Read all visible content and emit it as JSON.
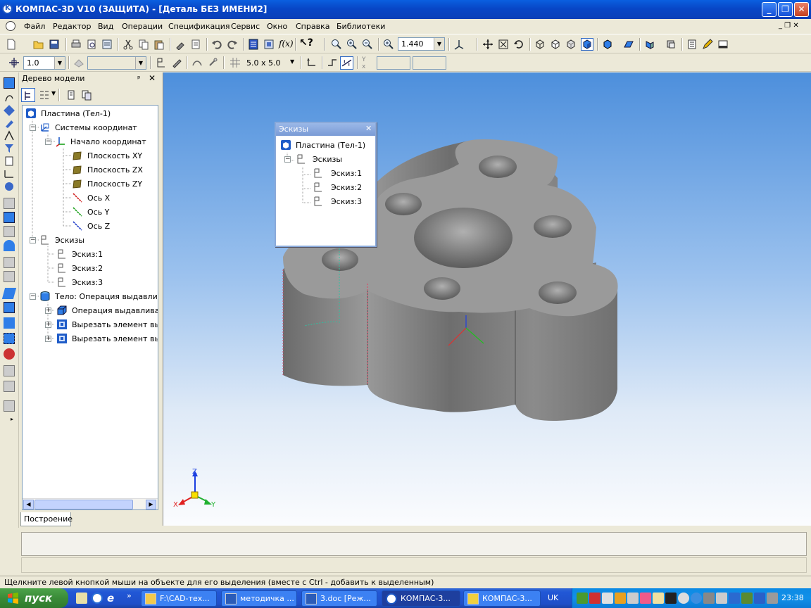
{
  "window": {
    "title": "КОМПАС-3D V10 (ЗАЩИТА) - [Деталь БЕЗ ИМЕНИ2]"
  },
  "menu": {
    "items": [
      "Файл",
      "Редактор",
      "Вид",
      "Операции",
      "Спецификация",
      "Сервис",
      "Окно",
      "Справка",
      "Библиотеки"
    ]
  },
  "toolbar": {
    "zoom_value": "1.440",
    "scale_value": "1.0",
    "grid_value": "5.0 x 5.0"
  },
  "tree_panel": {
    "title": "Дерево модели",
    "tab_label": "Построение",
    "items": [
      {
        "label": "Пластина  (Тел-1)"
      },
      {
        "label": "Системы координат"
      },
      {
        "label": "Начало координат"
      },
      {
        "label": "Плоскость XY"
      },
      {
        "label": "Плоскость ZX"
      },
      {
        "label": "Плоскость ZY"
      },
      {
        "label": "Ось X"
      },
      {
        "label": "Ось Y"
      },
      {
        "label": "Ось Z"
      },
      {
        "label": "Эскизы"
      },
      {
        "label": "Эскиз:1"
      },
      {
        "label": "Эскиз:2"
      },
      {
        "label": "Эскиз:3"
      },
      {
        "label": "Тело:  Операция выдавлив"
      },
      {
        "label": "Операция выдавливан"
      },
      {
        "label": "Вырезать элемент вы,"
      },
      {
        "label": "Вырезать элемент вы,"
      }
    ]
  },
  "sketch_popup": {
    "title": "Эскизы",
    "items": [
      {
        "label": "Пластина  (Тел-1)"
      },
      {
        "label": "Эскизы"
      },
      {
        "label": "Эскиз:1"
      },
      {
        "label": "Эскиз:2"
      },
      {
        "label": "Эскиз:3"
      }
    ]
  },
  "viewport": {
    "axis_z": "Z",
    "axis_x": "X",
    "axis_y": "Y"
  },
  "status_text": "Щелкните левой кнопкой мыши на объекте для его выделения (вместе с Ctrl - добавить к выделенным)",
  "taskbar": {
    "start_label": "пуск",
    "tasks": [
      {
        "label": "F:\\CAD-тех..."
      },
      {
        "label": "методичка ..."
      },
      {
        "label": "3.doc [Реж..."
      },
      {
        "label": "КОМПАС-3..."
      },
      {
        "label": "КОМПАС-3..."
      }
    ],
    "lang": "UK",
    "clock": "23:38"
  }
}
